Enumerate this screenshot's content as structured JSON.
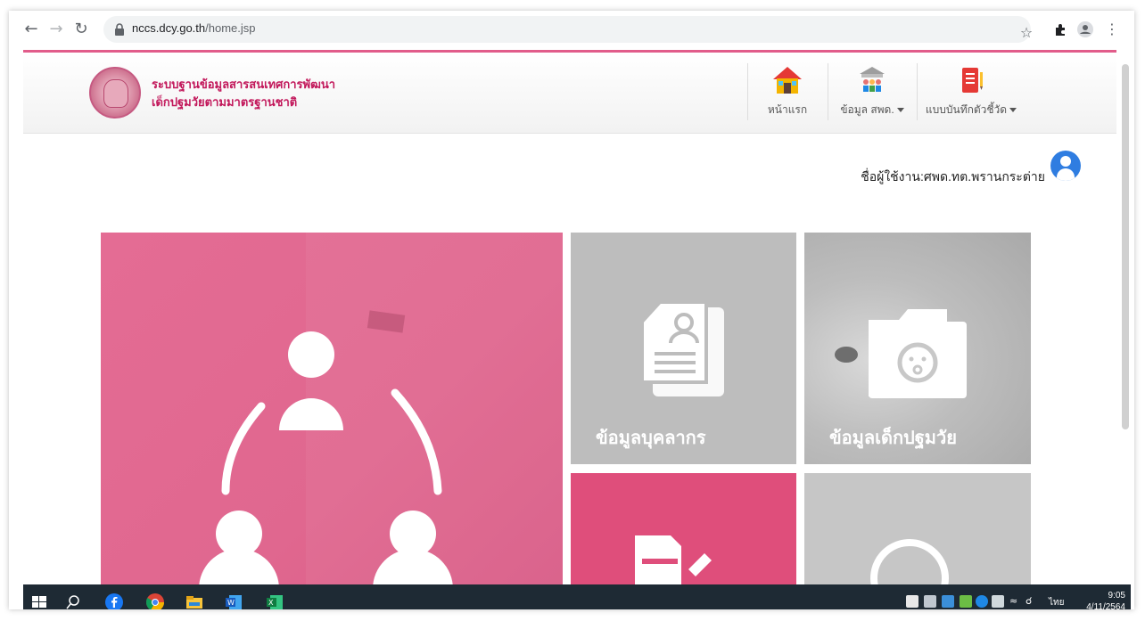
{
  "browser": {
    "url_host": "nccs.dcy.go.th",
    "url_path": "/home.jsp"
  },
  "site": {
    "title_line1": "ระบบฐานข้อมูลสารสนเทศการพัฒนา",
    "title_line2": "เด็กปฐมวัยตามมาตรฐานชาติ"
  },
  "menu": {
    "items": [
      {
        "label": "หน้าแรก",
        "icon": "house-icon",
        "dropdown": false
      },
      {
        "label": "ข้อมูล สพด.",
        "icon": "school-people-icon",
        "dropdown": true
      },
      {
        "label": "แบบบันทึกตัวชี้วัด",
        "icon": "record-book-icon",
        "dropdown": true
      }
    ]
  },
  "user": {
    "label": "ชื่อผู้ใช้งาน:ศพด.ทต.พรานกระต่าย",
    "icon": "user-avatar-icon"
  },
  "tiles": [
    {
      "label": "",
      "icon": "people-network-icon",
      "color": "#e0678f"
    },
    {
      "label": "ข้อมูลบุคลากร",
      "icon": "personnel-document-icon",
      "color": "#bdbdbd"
    },
    {
      "label": "ข้อมูลเด็กปฐมวัย",
      "icon": "child-folder-icon",
      "color": "#c8c8c8"
    },
    {
      "label": "",
      "icon": "edit-document-icon",
      "color": "#df4e7b"
    },
    {
      "label": "",
      "icon": "circle-icon",
      "color": "#c6c6c6"
    }
  ],
  "taskbar": {
    "lang": "ไทย",
    "time": "9:05",
    "date": "4/11/2564"
  },
  "colors": {
    "accent": "#e15c8a",
    "title": "#c2185b",
    "avatar": "#2f7de1"
  }
}
